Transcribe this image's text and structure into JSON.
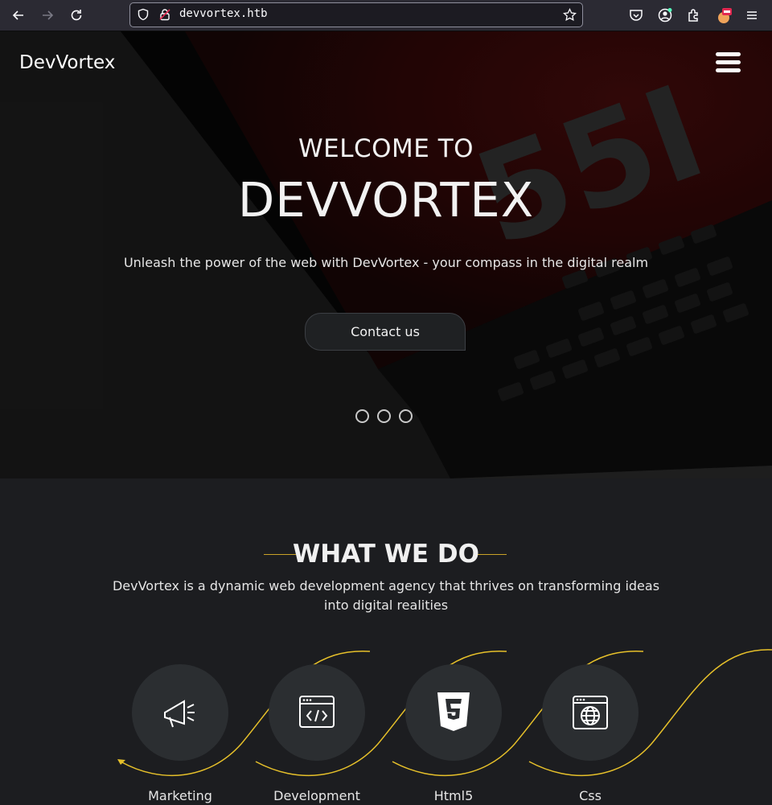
{
  "browser": {
    "url": "devvortex.htb",
    "icons": [
      "back-icon",
      "forward-icon",
      "reload-icon",
      "shield-icon",
      "lock-icon",
      "star-icon",
      "pocket-icon",
      "account-icon",
      "extensions-icon",
      "profile-icon",
      "menu-icon"
    ]
  },
  "hero": {
    "brand": "DevVortex",
    "kicker": "WELCOME TO",
    "title": "DEVVORTEX",
    "subtitle": "Unleash the power of the web with DevVortex - your compass in the digital realm",
    "cta": "Contact us",
    "slides": 3
  },
  "what_we_do": {
    "title": "WHAT WE DO",
    "description_line1": "DevVortex is a dynamic web development agency that thrives on transforming ideas",
    "description_line2": "into digital realities",
    "services": [
      {
        "label": "Marketing",
        "icon": "megaphone-icon"
      },
      {
        "label": "Development",
        "icon": "code-window-icon"
      },
      {
        "label": "Html5",
        "icon": "html5-icon"
      },
      {
        "label": "Css",
        "icon": "globe-window-icon"
      }
    ],
    "accent": "#e6c02a"
  }
}
